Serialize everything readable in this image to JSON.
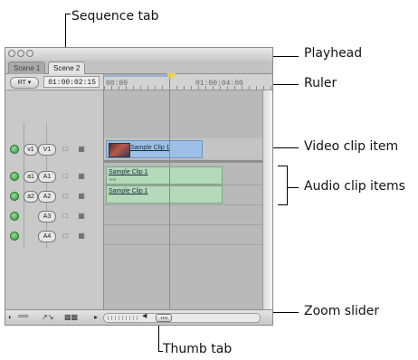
{
  "window": {
    "tabs": [
      {
        "label": "Scene 1",
        "active": false
      },
      {
        "label": "Scene 2",
        "active": true
      }
    ],
    "rt_button": "RT",
    "timecode": "01:00:02:15",
    "ruler": {
      "start_label": "00:00",
      "mark_label": "01:00:04:00"
    },
    "tracks": {
      "video": [
        {
          "source": "v1",
          "dest": "V1"
        }
      ],
      "audio": [
        {
          "source": "a1",
          "dest": "A1"
        },
        {
          "source": "a2",
          "dest": "A2"
        },
        {
          "source": "",
          "dest": "A3"
        },
        {
          "source": "",
          "dest": "A4"
        }
      ]
    },
    "clips": {
      "video": "Sample Clip 1",
      "audio_1": "Sample Clip 1",
      "audio_2": "Sample Clip 1"
    }
  },
  "callouts": {
    "sequence_tab": "Sequence tab",
    "playhead": "Playhead",
    "ruler": "Ruler",
    "video_clip_item": "Video clip item",
    "audio_clip_items": "Audio clip items",
    "zoom_slider": "Zoom slider",
    "thumb_tab": "Thumb tab"
  },
  "colors": {
    "video_clip": "#9dc0e6",
    "audio_clip": "#b4d9bb",
    "playhead_marker": "#f1d239",
    "track_enable": "#2e9a3a"
  },
  "icons": [
    "speaker-icon",
    "lock-icon",
    "auto-select-icon",
    "clip-overlays-icon",
    "track-height-icon",
    "clip-keyframes-icon",
    "scroll-arrow-icon"
  ]
}
